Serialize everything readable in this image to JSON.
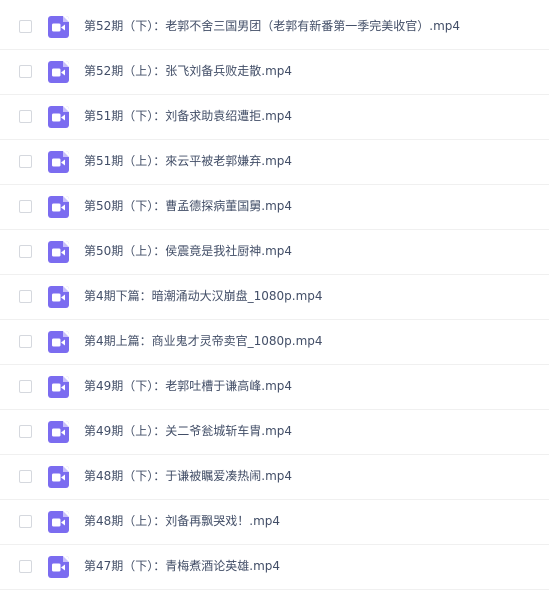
{
  "icon": "video-file-icon",
  "colors": {
    "icon_bg": "#7b6cf0",
    "text": "#424e67",
    "divider": "#f0f0f0"
  },
  "files": [
    {
      "name": "第52期（下）：老郭不舍三国男团（老郭有新番第一季完美收官）.mp4"
    },
    {
      "name": "第52期（上）：张飞刘备兵败走散.mp4"
    },
    {
      "name": "第51期（下）：刘备求助袁绍遭拒.mp4"
    },
    {
      "name": "第51期（上）：來云平被老郭嫌弃.mp4"
    },
    {
      "name": "第50期（下）：曹孟德探病董国舅.mp4"
    },
    {
      "name": "第50期（上）：侯震竟是我社厨神.mp4"
    },
    {
      "name": "第4期下篇：暗潮涌动大汉崩盘_1080p.mp4"
    },
    {
      "name": "第4期上篇：商业鬼才灵帝卖官_1080p.mp4"
    },
    {
      "name": "第49期（下）：老郭吐槽于谦高峰.mp4"
    },
    {
      "name": "第49期（上）：关二爷瓮城斩车胄.mp4"
    },
    {
      "name": "第48期（下）：于谦被瞩爱凑热闹.mp4"
    },
    {
      "name": "第48期（上）：刘备再飘哭戏！.mp4"
    },
    {
      "name": "第47期（下）：青梅煮酒论英雄.mp4"
    }
  ]
}
